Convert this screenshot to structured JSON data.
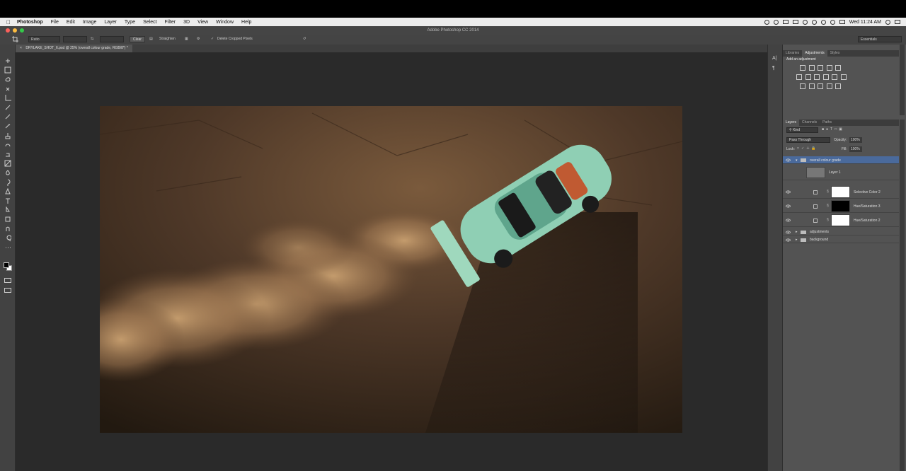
{
  "menubar": {
    "app": "Photoshop",
    "items": [
      "File",
      "Edit",
      "Image",
      "Layer",
      "Type",
      "Select",
      "Filter",
      "3D",
      "View",
      "Window",
      "Help"
    ],
    "clock": "Wed 11:24 AM"
  },
  "window": {
    "title": "Adobe Photoshop CC 2014",
    "workspace": "Essentials"
  },
  "options": {
    "ratio": "Ratio",
    "clear": "Clear",
    "straighten": "Straighten",
    "delete_cropped": "Delete Cropped Pixels"
  },
  "document": {
    "tab": "DRYLAKE_SHOT_6.psd @ 25% (overall colour grade, RGB/8*) *"
  },
  "panels": {
    "top_tabs": [
      "Libraries",
      "Adjustments",
      "Styles"
    ],
    "add_adjustment": "Add an adjustment",
    "layer_tabs": [
      "Layers",
      "Channels",
      "Paths"
    ],
    "kind": "Kind",
    "blend_mode": "Pass Through",
    "opacity_label": "Opacity:",
    "opacity": "100%",
    "lock_label": "Lock:",
    "fill_label": "Fill:",
    "fill": "100%"
  },
  "layers": [
    {
      "name": "overall colour grade",
      "type": "group-open"
    },
    {
      "name": "Layer 1",
      "type": "pixel"
    },
    {
      "name": "Selective Color 2",
      "type": "adjustment"
    },
    {
      "name": "Hue/Saturation 3",
      "type": "adjustment"
    },
    {
      "name": "Hue/Saturation 2",
      "type": "adjustment"
    },
    {
      "name": "adjustments",
      "type": "group"
    },
    {
      "name": "background",
      "type": "group"
    }
  ],
  "colors": {
    "accent": "#4a6a9c",
    "car": "#8fcfb4"
  }
}
